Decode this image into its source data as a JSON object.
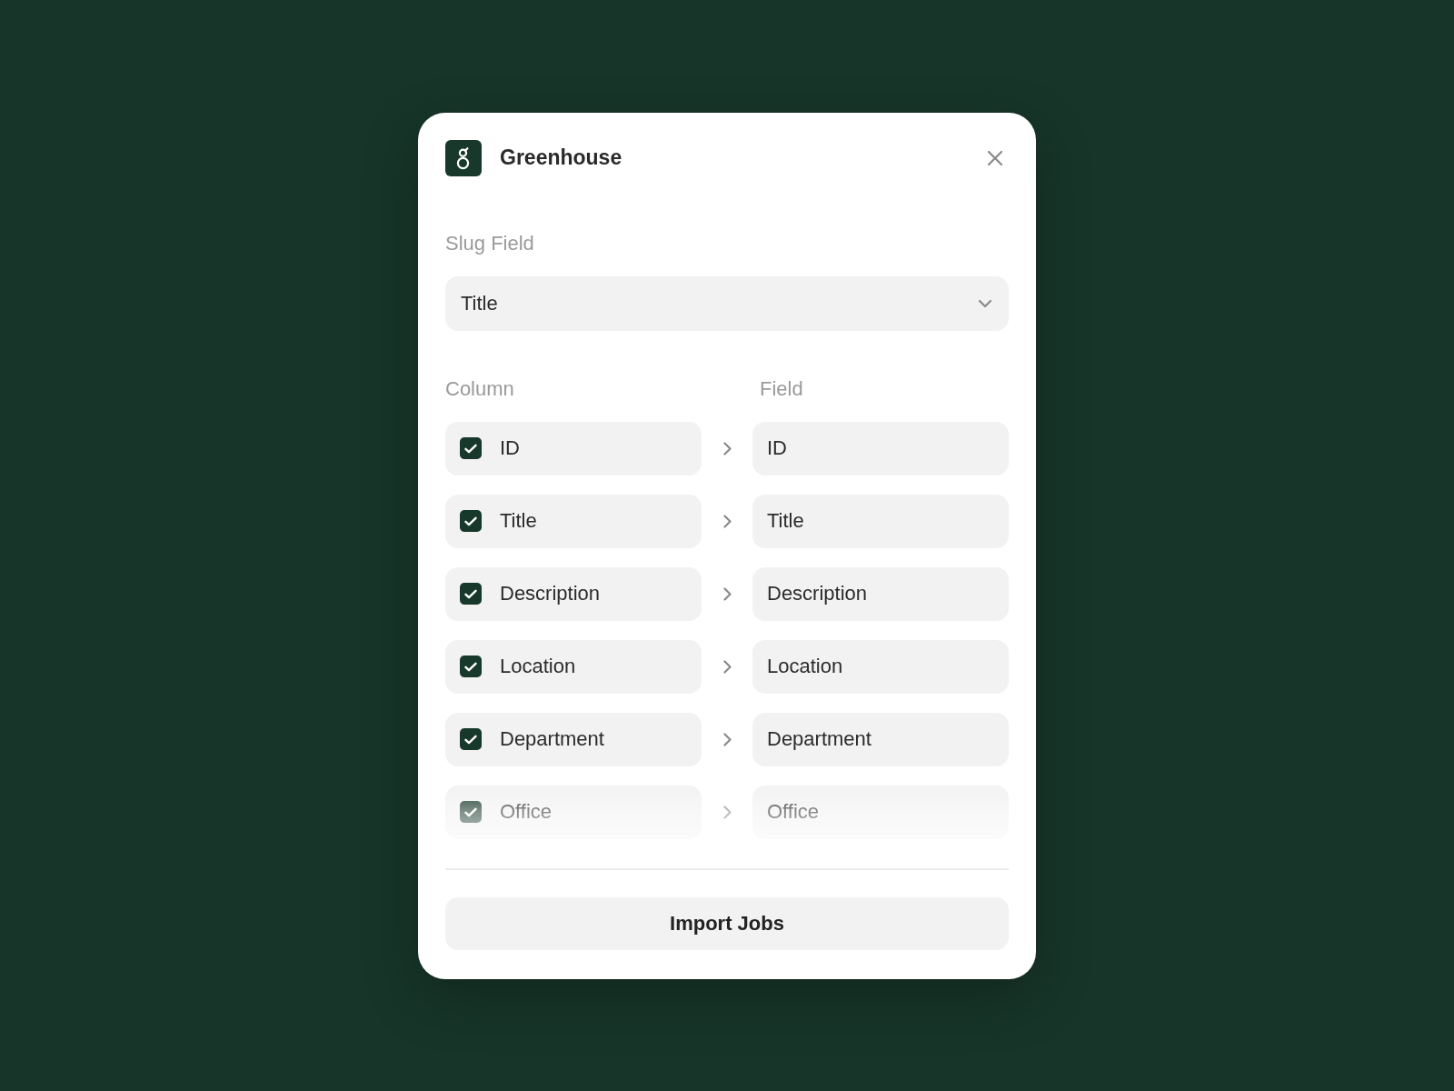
{
  "dialog": {
    "title": "Greenhouse"
  },
  "slug_field": {
    "label": "Slug Field",
    "value": "Title"
  },
  "mapping": {
    "column_header": "Column",
    "field_header": "Field",
    "rows": [
      {
        "column": "ID",
        "checked": true,
        "field": "ID"
      },
      {
        "column": "Title",
        "checked": true,
        "field": "Title"
      },
      {
        "column": "Description",
        "checked": true,
        "field": "Description"
      },
      {
        "column": "Location",
        "checked": true,
        "field": "Location"
      },
      {
        "column": "Department",
        "checked": true,
        "field": "Department"
      },
      {
        "column": "Office",
        "checked": true,
        "field": "Office"
      }
    ]
  },
  "import_button": "Import Jobs"
}
